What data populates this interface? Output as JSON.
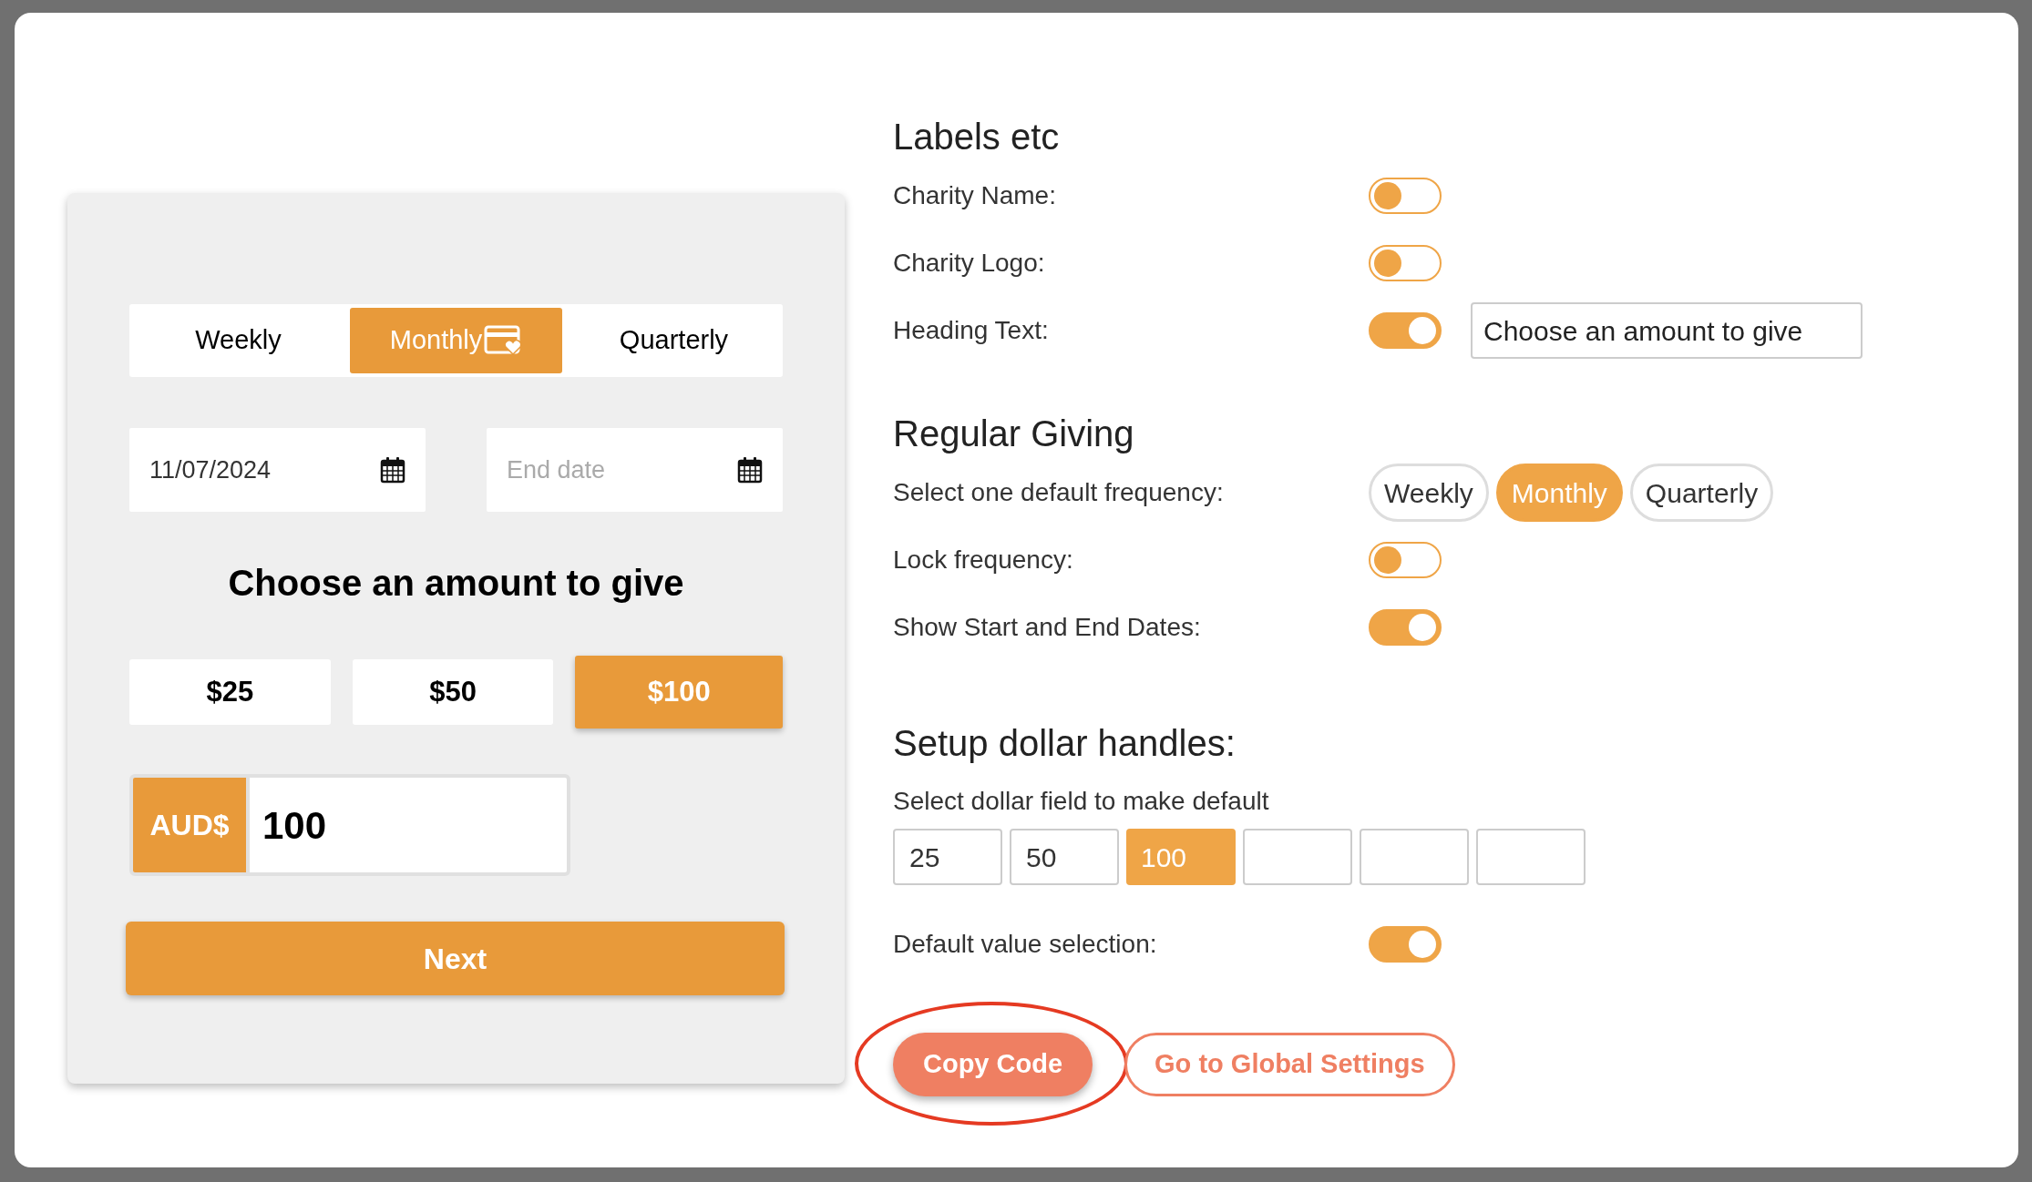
{
  "preview": {
    "frequency_tabs": [
      {
        "label": "Weekly",
        "selected": false
      },
      {
        "label": "Monthly",
        "selected": true
      },
      {
        "label": "Quarterly",
        "selected": false
      }
    ],
    "start_date": {
      "value": "11/07/2024"
    },
    "end_date": {
      "placeholder": "End date"
    },
    "heading": "Choose an amount to give",
    "amounts": [
      {
        "label": "$25",
        "selected": false
      },
      {
        "label": "$50",
        "selected": false
      },
      {
        "label": "$100",
        "selected": true
      }
    ],
    "currency": "AUD$",
    "amount_value": "100",
    "next_button": "Next"
  },
  "settings": [
    {
      "title": "Labels etc",
      "rows": [
        {
          "kind": "toggle",
          "label": "Charity Name:",
          "on": false
        },
        {
          "kind": "toggle",
          "label": "Charity Logo:",
          "on": false
        },
        {
          "kind": "toggle",
          "label": "Heading Text:",
          "on": true,
          "value": "Choose an amount to give"
        }
      ]
    },
    {
      "title": "Regular Giving",
      "rows": [
        {
          "kind": "pills",
          "label": "Select one default frequency:",
          "options": [
            {
              "label": "Weekly",
              "selected": false
            },
            {
              "label": "Monthly",
              "selected": true
            },
            {
              "label": "Quarterly",
              "selected": false
            }
          ]
        },
        {
          "kind": "toggle",
          "label": "Lock frequency:",
          "on": false
        },
        {
          "kind": "toggle",
          "label": "Show Start and End Dates:",
          "on": true
        }
      ]
    },
    {
      "title": "Setup dollar handles:",
      "rows": [
        {
          "kind": "handles",
          "label": "Select dollar field to make default",
          "handles": [
            {
              "value": "25",
              "selected": false
            },
            {
              "value": "50",
              "selected": false
            },
            {
              "value": "100",
              "selected": true
            },
            {
              "selected": false
            },
            {
              "selected": false
            },
            {
              "selected": false
            }
          ]
        },
        {
          "kind": "toggle",
          "label": "Default value selection:",
          "on": true
        }
      ]
    }
  ],
  "buttons": [
    {
      "label": "Copy Code",
      "kind": "primary",
      "circled": true
    },
    {
      "label": "Go to Global Settings",
      "kind": "outline",
      "circled": false
    }
  ]
}
